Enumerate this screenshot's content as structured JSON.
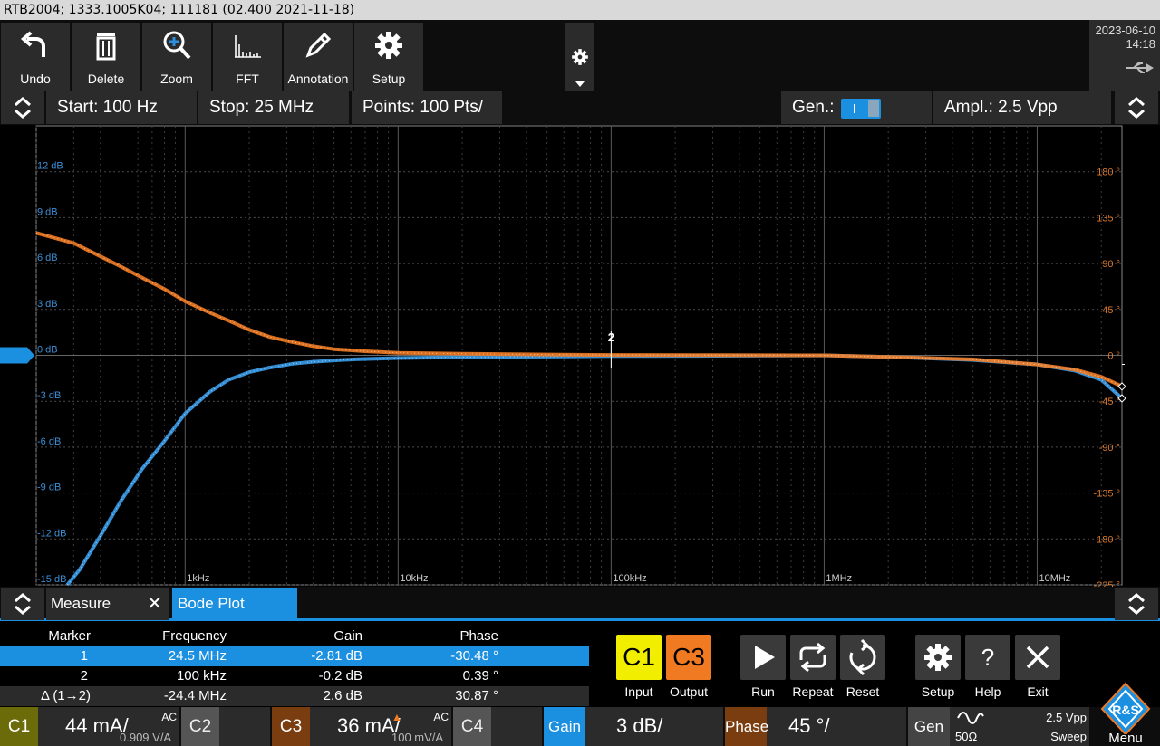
{
  "title_bar": {
    "text": "RTB2004; 1333.1005K04; 111181 (02.400 2021-11-18)"
  },
  "toolbar": {
    "buttons": [
      {
        "label": "Undo",
        "icon": "undo-arrow-icon"
      },
      {
        "label": "Delete",
        "icon": "trash-icon"
      },
      {
        "label": "Zoom",
        "icon": "zoom-in-icon"
      },
      {
        "label": "FFT",
        "icon": "fft-spectrum-icon"
      },
      {
        "label": "Annotation",
        "icon": "pencil-icon"
      },
      {
        "label": "Setup",
        "icon": "gear-icon"
      }
    ]
  },
  "status_right": {
    "date": "2023-06-10",
    "time": "14:18"
  },
  "params": {
    "start": "Start: 100 Hz",
    "stop": "Stop: 25 MHz",
    "points": "Points: 100 Pts/",
    "gen_label": "Gen.:",
    "ampl": "Ampl.: 2.5 Vpp"
  },
  "chart_data": {
    "type": "line",
    "x_scale": "log",
    "xlim": [
      200,
      25000000
    ],
    "x_ticks": [
      {
        "value": 1000,
        "label": "1kHz"
      },
      {
        "value": 10000,
        "label": "10kHz"
      },
      {
        "value": 100000,
        "label": "100kHz"
      },
      {
        "value": 1000000,
        "label": "1MHz"
      },
      {
        "value": 10000000,
        "label": "10MHz"
      }
    ],
    "left_axis": {
      "ylim": [
        -15,
        15
      ],
      "ticks": [
        "12 dB",
        "9 dB",
        "6 dB",
        "3 dB",
        "0 dB",
        "-3 dB",
        "-6 dB",
        "-9 dB",
        "-12 dB",
        "-15 dB"
      ],
      "values": [
        12,
        9,
        6,
        3,
        0,
        -3,
        -6,
        -9,
        -12,
        -15
      ],
      "color": "#3c8fd6"
    },
    "right_axis": {
      "ylim": [
        -225,
        225
      ],
      "ticks": [
        "180 °",
        "135 °",
        "90 °",
        "45 °",
        "0 °",
        "-45 °",
        "-90 °",
        "-135 °",
        "-180 °",
        "-225 °"
      ],
      "values": [
        180,
        135,
        90,
        45,
        0,
        -45,
        -90,
        -135,
        -180,
        -225
      ],
      "color": "#d9782a"
    },
    "grid": true,
    "series": [
      {
        "axis": "left",
        "color": "#3a9be8",
        "x": [
          280,
          320,
          400,
          500,
          630,
          800,
          1000,
          1300,
          1600,
          2000,
          2500,
          3200,
          4000,
          5000,
          6300,
          10000,
          20000,
          50000,
          100000,
          300000,
          1000000,
          2000000,
          5000000,
          10000000,
          15000000,
          20000000,
          25000000
        ],
        "y": [
          -15,
          -14,
          -11.8,
          -9.5,
          -7.4,
          -5.6,
          -3.8,
          -2.4,
          -1.6,
          -1.1,
          -0.8,
          -0.55,
          -0.42,
          -0.33,
          -0.26,
          -0.18,
          -0.12,
          -0.08,
          -0.05,
          -0.03,
          0,
          -0.1,
          -0.3,
          -0.6,
          -1.0,
          -1.6,
          -2.81
        ]
      },
      {
        "axis": "right",
        "color": "#ef7a22",
        "x": [
          200,
          300,
          400,
          500,
          630,
          800,
          1000,
          1300,
          1600,
          2000,
          2500,
          3200,
          4000,
          5000,
          7000,
          10000,
          20000,
          50000,
          100000,
          300000,
          1000000,
          2000000,
          5000000,
          10000000,
          15000000,
          20000000,
          25000000
        ],
        "y": [
          120,
          110,
          97,
          87,
          76,
          65,
          53,
          42,
          34,
          25,
          18,
          13,
          9,
          6,
          4,
          2.5,
          1.5,
          0.8,
          0.39,
          0.2,
          0,
          -1.5,
          -4,
          -9,
          -14,
          -21,
          -30.48
        ]
      }
    ],
    "marker": {
      "label": "2",
      "x": 100000
    }
  },
  "lower_bar": {
    "measure": "Measure",
    "tab": "Bode Plot"
  },
  "marker_table": {
    "headers": [
      "Marker",
      "Frequency",
      "Gain",
      "Phase"
    ],
    "rows": [
      {
        "marker": "1",
        "frequency": "24.5 MHz",
        "gain": "-2.81 dB",
        "phase": "-30.48 °"
      },
      {
        "marker": "2",
        "frequency": "100 kHz",
        "gain": "-0.2 dB",
        "phase": "0.39 °"
      },
      {
        "marker": "Δ (1→2)",
        "frequency": "-24.4 MHz",
        "gain": "2.6 dB",
        "phase": "30.87 °"
      }
    ]
  },
  "controls": {
    "input_ch": "C1",
    "input_label": "Input",
    "output_ch": "C3",
    "output_label": "Output",
    "run": "Run",
    "repeat": "Repeat",
    "reset": "Reset",
    "setup": "Setup",
    "help": "Help",
    "exit": "Exit"
  },
  "status_bar": {
    "c1": {
      "tag": "C1",
      "value": "44 mA/",
      "coupling": "AC",
      "sub": "0.909 V/A"
    },
    "c2": {
      "tag": "C2"
    },
    "c3": {
      "tag": "C3",
      "value": "36 mA/",
      "coupling": "AC",
      "sub": "100 mV/A"
    },
    "c4": {
      "tag": "C4"
    },
    "gain": {
      "tag": "Gain",
      "value": "3 dB/"
    },
    "phase": {
      "tag": "Phase",
      "value": "45 °/"
    },
    "gen": {
      "tag": "Gen",
      "imp": "50Ω",
      "ampl": "2.5 Vpp",
      "mode": "Sweep"
    },
    "menu": "Menu",
    "logo": "R&S"
  },
  "colors": {
    "c1": "#f2ee00",
    "c3": "#ef7a22",
    "gain": "#1b8fe0",
    "phase": "#d9782a"
  }
}
